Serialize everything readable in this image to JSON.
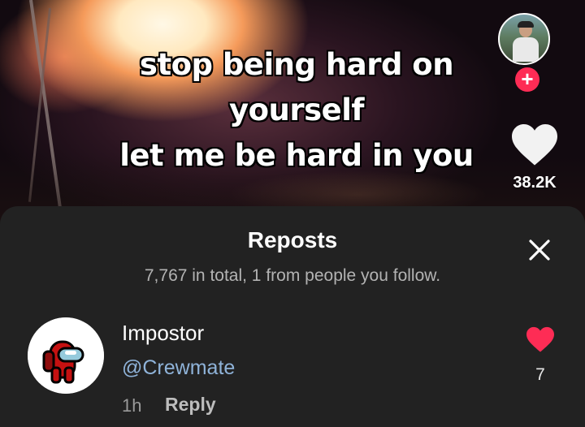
{
  "video": {
    "caption_lines": [
      "stop being hard on",
      "yourself",
      "let me be hard in you"
    ],
    "like_count": "38.2K",
    "follow_symbol": "+"
  },
  "reposts_sheet": {
    "title": "Reposts",
    "subtitle": "7,767 in total, 1 from people you follow.",
    "close_icon": "close-icon",
    "items": [
      {
        "name": "Impostor",
        "handle": "@Crewmate",
        "time": "1h",
        "reply_label": "Reply",
        "like_count": "7"
      }
    ]
  },
  "colors": {
    "sheet_bg": "#222222",
    "accent_red": "#fe2c55",
    "handle_blue": "#8fb3d9",
    "like_heart": "#fe2c55"
  }
}
